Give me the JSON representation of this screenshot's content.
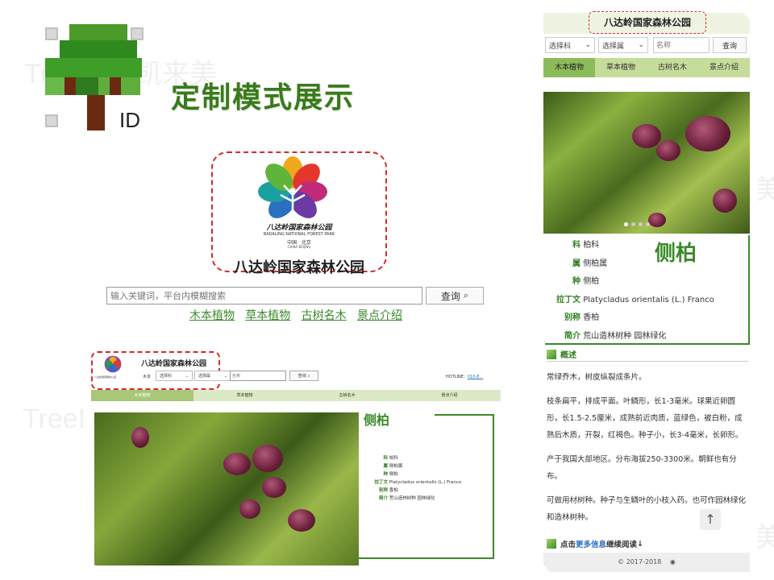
{
  "header": {
    "title": "定制模式展示",
    "logo_text": "ID"
  },
  "watermark": "TreeID@凯来美",
  "home": {
    "park_name": "八达岭国家森林公园",
    "logo_cn": "八达岭国家森林公园",
    "logo_en": "BADALING NATIONAL FOREST PARK",
    "logo_city": "中国 · 北京",
    "logo_city_en": "CHINA  BEIJING",
    "search_placeholder": "输入关键词，平台内模糊搜索",
    "search_button": "查询",
    "nav": [
      "木本植物",
      "草本植物",
      "古树名木",
      "景点介绍"
    ]
  },
  "desktop": {
    "park_name": "八达岭国家森林公园",
    "filter_label": "木本",
    "select_family": "选择科",
    "select_genus": "选择属",
    "name_placeholder": "名称",
    "search_button": "查询",
    "hotline": "HOTLINE：",
    "hotline_num": "010-8...",
    "tabs": [
      "木本植物",
      "草本植物",
      "古树名木",
      "景点介绍"
    ],
    "plant_title": "侧柏",
    "fields": [
      {
        "k": "科",
        "v": "柏科"
      },
      {
        "k": "属",
        "v": "侧柏属"
      },
      {
        "k": "种",
        "v": "侧柏"
      },
      {
        "k": "拉丁文",
        "v": "Platycladus orientalis (L.) Franco"
      },
      {
        "k": "别称",
        "v": "香柏"
      },
      {
        "k": "简介",
        "v": "荒山造林树种 园林绿化"
      }
    ]
  },
  "mobile": {
    "park_name": "八达岭国家森林公园",
    "select_family": "选择科",
    "select_genus": "选择属",
    "name_placeholder": "名称",
    "search_button": "查询",
    "tabs": [
      "木本植物",
      "草本植物",
      "古树名木",
      "景点介绍"
    ],
    "plant_title": "侧柏",
    "fields": [
      {
        "k": "科",
        "v": "柏科"
      },
      {
        "k": "属",
        "v": "侧柏属"
      },
      {
        "k": "种",
        "v": "侧柏"
      },
      {
        "k": "拉丁文",
        "v": "Platycladus orientalis (L.) Franco"
      },
      {
        "k": "别称",
        "v": "香柏"
      },
      {
        "k": "简介",
        "v": "荒山造林树种 园林绿化"
      }
    ],
    "overview_label": "概述",
    "paragraphs": [
      "常绿乔木，树皮纵裂成条片。",
      "枝条扁平，排成平面。叶鳞形，长1-3毫米。球果近卵圆形，长1.5-2.5厘米，成熟前近肉质，蓝绿色，被白粉，成熟后木质，开裂，红褐色。种子小，长3-4毫米，长卵形。",
      "产于我国大部地区。分布海拔250-3300米。朝鲜也有分布。",
      "可做用材树种。种子与生鳞叶的小枝入药。也可作园林绿化和造林树种。"
    ],
    "more_prefix": "点击",
    "more_link": "更多信息",
    "more_suffix": "继续阅读",
    "footer": "© 2017-2018"
  },
  "colors": {
    "brand_green": "#3a8a2a",
    "tab_bg": "#c5dc9a",
    "dash_red": "#d62a2a"
  }
}
